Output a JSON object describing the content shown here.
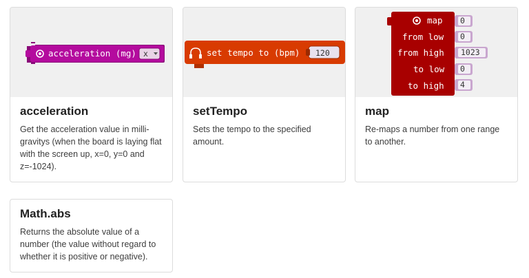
{
  "colors": {
    "acceleration_block": "#b40b9e",
    "acceleration_dark": "#8a0a79",
    "tempo_block": "#d83b01",
    "tempo_field": "#e8e1ee",
    "map_block": "#a80000",
    "map_dark": "#7a0000",
    "field_bg": "#e8e8f0"
  },
  "cards": [
    {
      "title": "acceleration",
      "description": "Get the acceleration value in milli-gravitys (when the board is laying flat with the screen up, x=0, y=0 and z=-1024).",
      "block": {
        "icon": "target-icon",
        "label": "acceleration (mg)",
        "dropdown_value": "x"
      }
    },
    {
      "title": "setTempo",
      "description": "Sets the tempo to the specified amount.",
      "block": {
        "icon": "headphones-icon",
        "label": "set tempo to (bpm)",
        "value": "120"
      }
    },
    {
      "title": "map",
      "description": "Re-maps a number from one range to another.",
      "block": {
        "icon": "target-icon",
        "rows": [
          {
            "label": "map",
            "value": "0"
          },
          {
            "label": "from low",
            "value": "0"
          },
          {
            "label": "from high",
            "value": "1023"
          },
          {
            "label": "to low",
            "value": "0"
          },
          {
            "label": "to high",
            "value": "4"
          }
        ]
      }
    },
    {
      "title": "Math.abs",
      "description": "Returns the absolute value of a number (the value without regard to whether it is positive or negative)."
    }
  ]
}
